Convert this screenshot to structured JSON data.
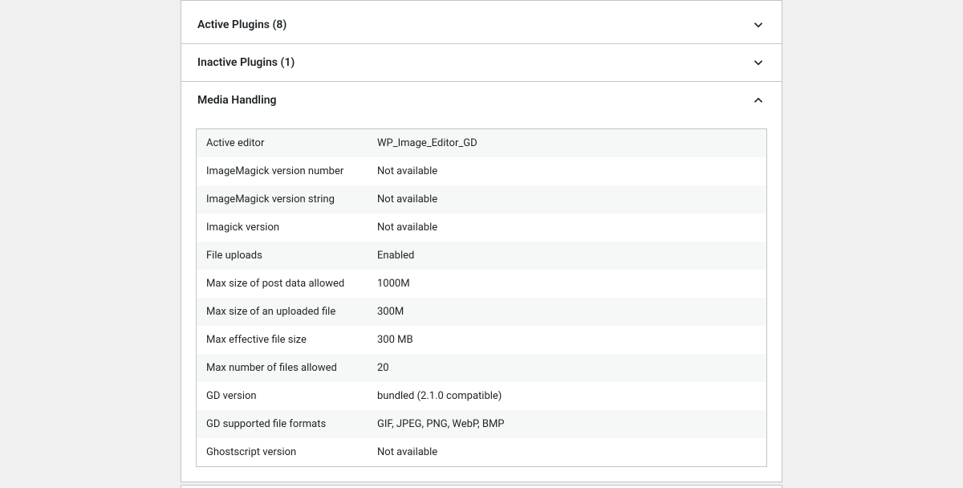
{
  "sections": {
    "active_plugins": {
      "title": "Active Plugins (8)",
      "expanded": false
    },
    "inactive_plugins": {
      "title": "Inactive Plugins (1)",
      "expanded": false
    },
    "media_handling": {
      "title": "Media Handling",
      "expanded": true,
      "rows": [
        {
          "label": "Active editor",
          "value": "WP_Image_Editor_GD"
        },
        {
          "label": "ImageMagick version number",
          "value": "Not available"
        },
        {
          "label": "ImageMagick version string",
          "value": "Not available"
        },
        {
          "label": "Imagick version",
          "value": "Not available"
        },
        {
          "label": "File uploads",
          "value": "Enabled"
        },
        {
          "label": "Max size of post data allowed",
          "value": "1000M"
        },
        {
          "label": "Max size of an uploaded file",
          "value": "300M"
        },
        {
          "label": "Max effective file size",
          "value": "300 MB"
        },
        {
          "label": "Max number of files allowed",
          "value": "20"
        },
        {
          "label": "GD version",
          "value": "bundled (2.1.0 compatible)"
        },
        {
          "label": "GD supported file formats",
          "value": "GIF, JPEG, PNG, WebP, BMP"
        },
        {
          "label": "Ghostscript version",
          "value": "Not available"
        }
      ]
    }
  }
}
